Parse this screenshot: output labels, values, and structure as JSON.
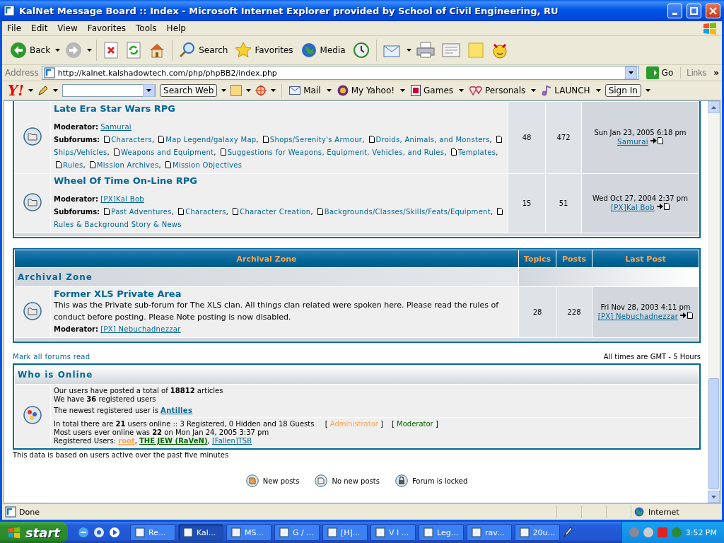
{
  "window": {
    "title": "KalNet Message Board :: Index - Microsoft Internet Explorer provided by School of Civil Engineering, RU"
  },
  "menu": [
    "File",
    "Edit",
    "View",
    "Favorites",
    "Tools",
    "Help"
  ],
  "toolbar": [
    {
      "kind": "back",
      "label": "Back"
    },
    {
      "kind": "forward"
    },
    {
      "kind": "stop"
    },
    {
      "kind": "refresh"
    },
    {
      "kind": "home"
    },
    {
      "kind": "search",
      "label": "Search"
    },
    {
      "kind": "favorites",
      "label": "Favorites"
    },
    {
      "kind": "media",
      "label": "Media"
    },
    {
      "kind": "history"
    },
    {
      "kind": "mail"
    },
    {
      "kind": "print"
    },
    {
      "kind": "edit"
    },
    {
      "kind": "discuss"
    },
    {
      "kind": "messenger"
    }
  ],
  "address": {
    "label": "Address",
    "url": "http://kalnet.kalshadowtech.com/php/phpBB2/index.php",
    "go": "Go",
    "links": "Links",
    "more": "»"
  },
  "yahoo_bar": {
    "logo": "Y!",
    "search_button": "Search Web",
    "items": [
      {
        "kind": "mail",
        "label": "Mail"
      },
      {
        "kind": "myyahoo",
        "label": "My Yahoo!"
      },
      {
        "kind": "games",
        "label": "Games"
      },
      {
        "kind": "personals",
        "label": "Personals"
      },
      {
        "kind": "launch",
        "label": "LAUNCH"
      }
    ],
    "sign_in": "Sign In"
  },
  "forums_top": [
    {
      "title": "Late Era Star Wars RPG",
      "moderator_label": "Moderator:",
      "moderators": [
        "Samurai"
      ],
      "subforums_label": "Subforums:",
      "subforums": [
        "Characters",
        "Map Legend/galaxy Map",
        "Shops/Serenity's Armour",
        "Droids, Animals, and Monsters",
        "Ships/Vehicles",
        "Weapons and Equipment",
        "Suggestions for Weapons, Equipment, Vehicles, and Rules",
        "Templates",
        "Rules",
        "Mission Archives",
        "Mission Objectives"
      ],
      "topics": "48",
      "posts": "472",
      "last_post": {
        "date": "Sun Jan 23, 2005 6:18 pm",
        "author": "Samurai"
      }
    },
    {
      "title": "Wheel Of Time On-Line RPG",
      "moderator_label": "Moderator:",
      "moderators": [
        "[PX]Kal Bob"
      ],
      "subforums_label": "Subforums:",
      "subforums": [
        "Past Adventures",
        "Characters",
        "Character Creation",
        "Backgrounds/Classes/Skills/Feats/Equipment",
        "Rules & Background Story & News"
      ],
      "topics": "15",
      "posts": "51",
      "last_post": {
        "date": "Wed Oct 27, 2004 2:37 pm",
        "author": "[PX]Kal Bob"
      }
    }
  ],
  "separator": ",",
  "archival": {
    "columns": [
      "Archival Zone",
      "Topics",
      "Posts",
      "Last Post"
    ],
    "category": "Archival Zone",
    "forums": [
      {
        "title": "Former XLS Private Area",
        "description": "This was the Private sub-forum for The XLS clan. All things clan related were spoken here. Please read the rules of conduct before posting. Please Note posting is now disabled.",
        "moderator_label": "Moderator:",
        "moderators": [
          "[PX] Nebuchadnezzar"
        ],
        "topics": "28",
        "posts": "228",
        "last_post": {
          "date": "Fri Nov 28, 2003 4:11 pm",
          "author": "[PX] Nebuchadnezzar"
        }
      }
    ]
  },
  "mark_all": "Mark all forums read",
  "timezone": "All times are GMT - 5 Hours",
  "who_is_online": {
    "title": "Who is Online",
    "stats": [
      "Our users have posted a total of **18812** articles",
      "We have **36** registered users"
    ],
    "newest_prefix": "The newest registered user is",
    "newest_user": "Antilles",
    "online": "In total there are **21** users online :: 3 Registered, 0 Hidden and 18 Guests",
    "groups": [
      {
        "open": "[",
        "name": "Administrator",
        "close": "]",
        "color": "#ffa34f"
      },
      {
        "open": "[",
        "name": "Moderator",
        "close": "]",
        "color": "#006600"
      }
    ],
    "record": "Most users ever online was **22** on Mon Jan 24, 2005 3:37 pm",
    "registered_label": "Registered Users:",
    "users": [
      {
        "name": "root",
        "color": "#ffa34f"
      },
      {
        "name": "THE JEW (RaVeN)",
        "color": "#006600"
      },
      {
        "name": "[Fallen]TSB",
        "color": "#006699"
      }
    ]
  },
  "footnote": "This data is based on users active over the past five minutes",
  "legend": [
    {
      "kind": "new",
      "label": "New posts"
    },
    {
      "kind": "none",
      "label": "No new posts"
    },
    {
      "kind": "locked",
      "label": "Forum is locked"
    }
  ],
  "status_bar": {
    "text": "Done",
    "zone": "Internet"
  },
  "taskbar": {
    "start": "start",
    "tasks": [
      {
        "label": "Re...",
        "selected": false
      },
      {
        "label": "Kal...",
        "selected": true
      },
      {
        "label": "MS...",
        "selected": false
      },
      {
        "label": "G / ...",
        "selected": false
      },
      {
        "label": "[H]...",
        "selected": false
      },
      {
        "label": "V I ...",
        "selected": false
      },
      {
        "label": "Leg...",
        "selected": false
      },
      {
        "label": "rav...",
        "selected": false
      },
      {
        "label": "20u...",
        "selected": false
      }
    ],
    "clock": "3:52 PM"
  }
}
